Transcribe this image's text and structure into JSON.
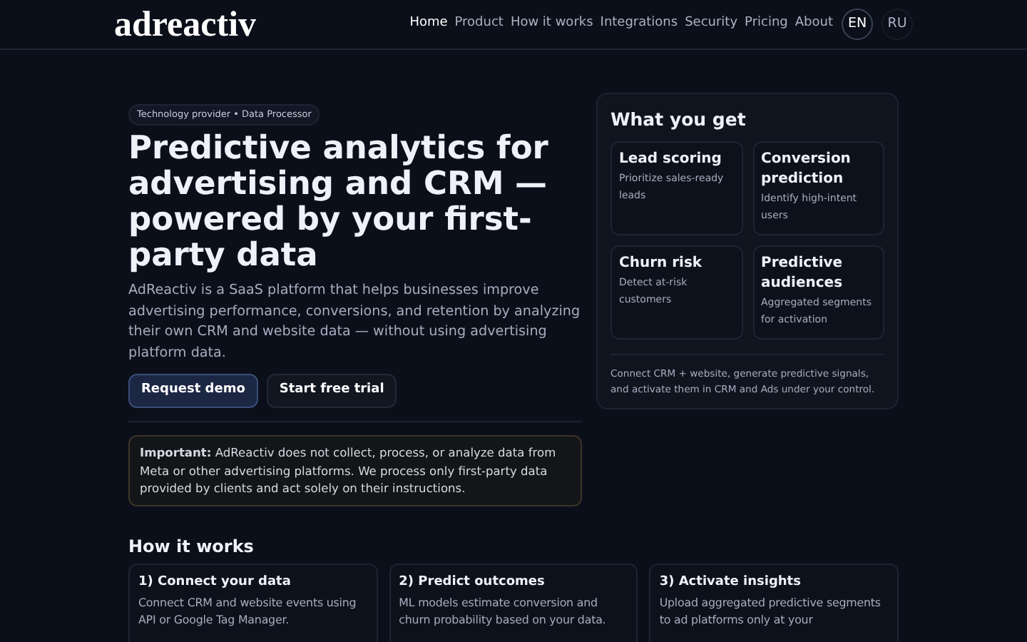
{
  "header": {
    "logo": "adreactiv",
    "nav": [
      {
        "label": "Home",
        "selected": true
      },
      {
        "label": "Product",
        "selected": false
      },
      {
        "label": "How it works",
        "selected": false
      },
      {
        "label": "Integrations",
        "selected": false
      },
      {
        "label": "Security",
        "selected": false
      },
      {
        "label": "Pricing",
        "selected": false
      },
      {
        "label": "About",
        "selected": false
      }
    ],
    "languages": [
      {
        "label": "EN",
        "selected": true
      },
      {
        "label": "RU",
        "selected": false
      }
    ]
  },
  "hero": {
    "badge": "Technology provider • Data Processor",
    "title": "Predictive analytics for advertising and CRM — powered by your first-party data",
    "description": "AdReactiv is a SaaS platform that helps businesses improve advertising performance, conversions, and retention by analyzing their own CRM and website data — without using advertising platform data.",
    "buttons": [
      {
        "label": "Request demo",
        "kind": "primary"
      },
      {
        "label": "Start free trial",
        "kind": "secondary"
      }
    ],
    "notice": "**Important:** AdReactiv does not collect, process, or analyze data from Meta or other advertising platforms. We process only first-party data provided by clients and act solely on their instructions."
  },
  "what_you_get": {
    "title": "What you get",
    "features": [
      {
        "title": "Lead scoring",
        "text": "Prioritize sales-ready leads"
      },
      {
        "title": "Conversion prediction",
        "text": "Identify high-intent users"
      },
      {
        "title": "Churn risk",
        "text": "Detect at-risk customers"
      },
      {
        "title": "Predictive audiences",
        "text": "Aggregated segments for activation"
      }
    ],
    "footer": "Connect CRM + website, generate predictive signals, and activate them in CRM and Ads under your control."
  },
  "how_it_works": {
    "title": "How it works",
    "steps": [
      {
        "title": "1) Connect your data",
        "text": "Connect CRM and website events using API or Google Tag Manager."
      },
      {
        "title": "2) Predict outcomes",
        "text": "ML models estimate conversion and churn probability based on your data."
      },
      {
        "title": "3) Activate insights",
        "text": "Upload aggregated predictive segments to ad platforms only at your"
      }
    ]
  }
}
